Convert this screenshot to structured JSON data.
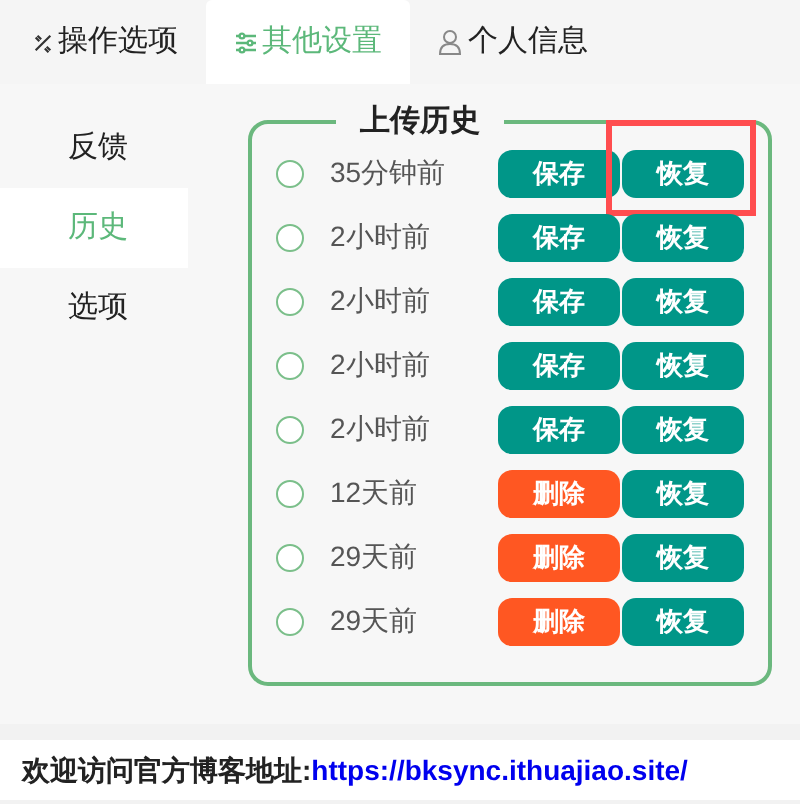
{
  "tabs": [
    {
      "label": "操作选项",
      "selected": false
    },
    {
      "label": "其他设置",
      "selected": true
    },
    {
      "label": "个人信息",
      "selected": false
    }
  ],
  "sidebar": {
    "items": [
      {
        "label": "反馈",
        "selected": false
      },
      {
        "label": "历史",
        "selected": true
      },
      {
        "label": "选项",
        "selected": false
      }
    ]
  },
  "history": {
    "title": "上传历史",
    "rows": [
      {
        "time": "35分钟前",
        "selected": false,
        "highlighted": true,
        "actions": [
          {
            "label": "保存",
            "kind": "save"
          },
          {
            "label": "恢复",
            "kind": "restore"
          }
        ]
      },
      {
        "time": "2小时前",
        "selected": false,
        "highlighted": false,
        "actions": [
          {
            "label": "保存",
            "kind": "save"
          },
          {
            "label": "恢复",
            "kind": "restore"
          }
        ]
      },
      {
        "time": "2小时前",
        "selected": false,
        "highlighted": false,
        "actions": [
          {
            "label": "保存",
            "kind": "save"
          },
          {
            "label": "恢复",
            "kind": "restore"
          }
        ]
      },
      {
        "time": "2小时前",
        "selected": false,
        "highlighted": false,
        "actions": [
          {
            "label": "保存",
            "kind": "save"
          },
          {
            "label": "恢复",
            "kind": "restore"
          }
        ]
      },
      {
        "time": "2小时前",
        "selected": false,
        "highlighted": false,
        "actions": [
          {
            "label": "保存",
            "kind": "save"
          },
          {
            "label": "恢复",
            "kind": "restore"
          }
        ]
      },
      {
        "time": "12天前",
        "selected": false,
        "highlighted": false,
        "actions": [
          {
            "label": "删除",
            "kind": "delete"
          },
          {
            "label": "恢复",
            "kind": "restore"
          }
        ]
      },
      {
        "time": "29天前",
        "selected": false,
        "highlighted": false,
        "actions": [
          {
            "label": "删除",
            "kind": "delete"
          },
          {
            "label": "恢复",
            "kind": "restore"
          }
        ]
      },
      {
        "time": "29天前",
        "selected": false,
        "highlighted": false,
        "actions": [
          {
            "label": "删除",
            "kind": "delete"
          },
          {
            "label": "恢复",
            "kind": "restore"
          }
        ]
      }
    ]
  },
  "footer": {
    "text": "欢迎访问官方博客地址:",
    "link": "https://bksync.ithuajiao.site/"
  }
}
